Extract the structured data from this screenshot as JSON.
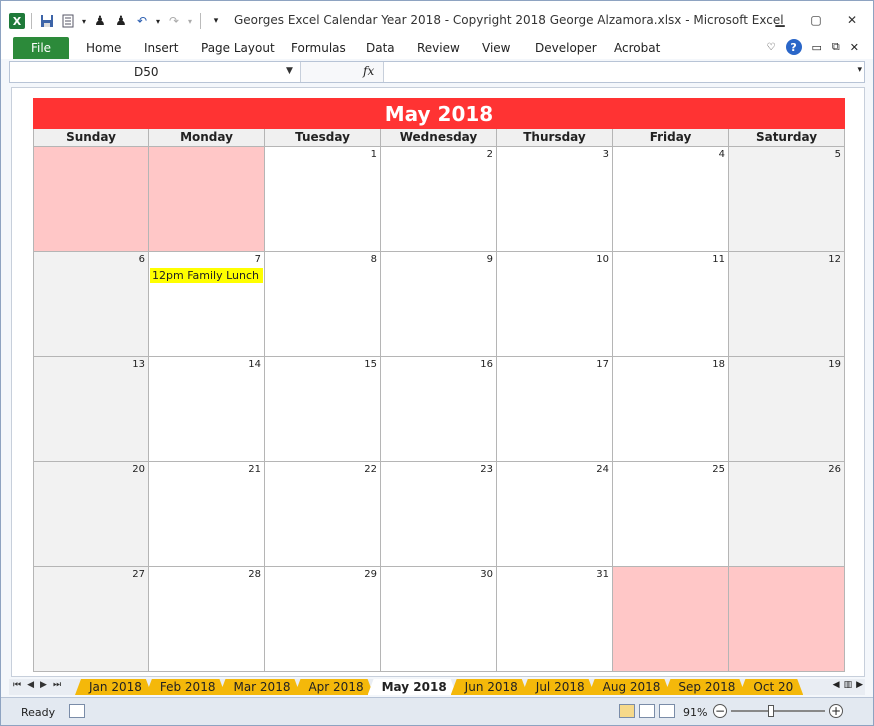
{
  "window": {
    "title": "Georges Excel Calendar Year 2018  -  Copyright 2018 George Alzamora.xlsx  -  Microsoft Excel",
    "controls": [
      "minimize",
      "restore",
      "close"
    ]
  },
  "ribbon": {
    "file_tab": "File",
    "tabs": [
      "Home",
      "Insert",
      "Page Layout",
      "Formulas",
      "Data",
      "Review",
      "View",
      "Developer",
      "Acrobat"
    ]
  },
  "formula_bar": {
    "name_box": "D50",
    "fx_label": "fx",
    "formula": ""
  },
  "calendar": {
    "month_title": "May 2018",
    "weekdays": [
      "Sunday",
      "Monday",
      "Tuesday",
      "Wednesday",
      "Thursday",
      "Friday",
      "Saturday"
    ],
    "weeks": [
      [
        "",
        "",
        "1",
        "2",
        "3",
        "4",
        "5"
      ],
      [
        "6",
        "7",
        "8",
        "9",
        "10",
        "11",
        "12"
      ],
      [
        "13",
        "14",
        "15",
        "16",
        "17",
        "18",
        "19"
      ],
      [
        "20",
        "21",
        "22",
        "23",
        "24",
        "25",
        "26"
      ],
      [
        "27",
        "28",
        "29",
        "30",
        "31",
        "",
        ""
      ]
    ],
    "event": {
      "day": "7",
      "text": "12pm Family Lunch"
    },
    "colors": {
      "header": "#ff3333",
      "blank_cells": "#ffc7c7",
      "weekend": "#f2f2f2",
      "event_highlight": "#ffff00"
    }
  },
  "sheet_tabs": {
    "tabs": [
      "Jan 2018",
      "Feb 2018",
      "Mar 2018",
      "Apr 2018",
      "May 2018",
      "Jun 2018",
      "Jul 2018",
      "Aug 2018",
      "Sep 2018",
      "Oct 20"
    ],
    "active": "May 2018",
    "tab_color": "#f4b80a"
  },
  "status_bar": {
    "status": "Ready",
    "zoom": "91%"
  }
}
